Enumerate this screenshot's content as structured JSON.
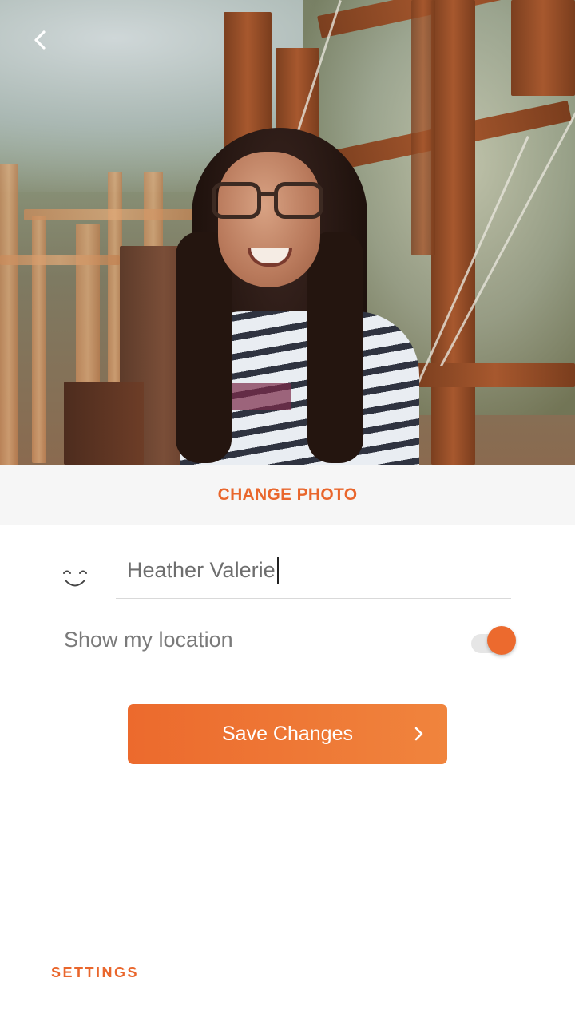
{
  "profile": {
    "change_photo_label": "CHANGE PHOTO",
    "name_value": "Heather Valerie",
    "location_label": "Show my location",
    "location_enabled": true
  },
  "actions": {
    "save_label": "Save Changes"
  },
  "footer": {
    "settings_label": "SETTINGS"
  },
  "icons": {
    "back": "chevron-left-icon",
    "name": "smile-icon",
    "save": "chevron-right-icon"
  },
  "colors": {
    "accent": "#ec6a2d",
    "accent_gradient_end": "#f0843d",
    "change_photo_bg": "#f6f6f6"
  }
}
